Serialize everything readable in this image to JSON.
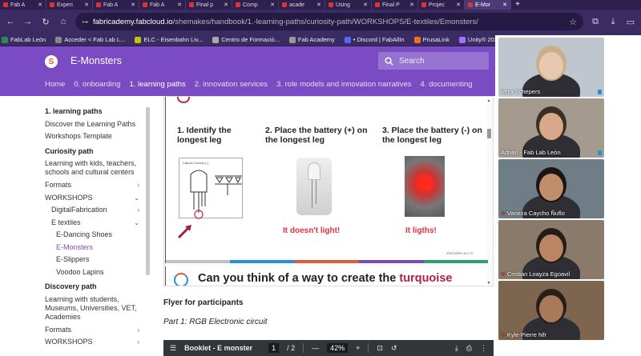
{
  "browser": {
    "tabs": [
      {
        "label": "Fab A",
        "active": false
      },
      {
        "label": "Experi",
        "active": false
      },
      {
        "label": "Fab A",
        "active": false
      },
      {
        "label": "Fab A",
        "active": false
      },
      {
        "label": "Final p",
        "active": false
      },
      {
        "label": "Comp",
        "active": false
      },
      {
        "label": "acade",
        "active": false
      },
      {
        "label": "Using",
        "active": false
      },
      {
        "label": "Final P",
        "active": false
      },
      {
        "label": "Projec",
        "active": false
      },
      {
        "label": "E-Mor",
        "active": true
      }
    ],
    "new_tab": "+",
    "url_host": "fabricademy.fabcloud.io",
    "url_path": "/shemakes/handbook/1.-learning-paths/curiosity-path/WORKSHOPS/E-textiles/Emonsters/",
    "bookmarks": [
      {
        "label": "FabLab León",
        "color": "#2e8b57"
      },
      {
        "label": "Acceder < Fab Lab L...",
        "color": "#888888"
      },
      {
        "label": "ELC - Eisenbahn Liv...",
        "color": "#c4c400"
      },
      {
        "label": "Centro de Formació...",
        "color": "#aaaaaa"
      },
      {
        "label": "Fab Academy",
        "color": "#999999"
      },
      {
        "label": "• Discord | FabAllIn",
        "color": "#5865f2"
      },
      {
        "label": "PrusaLink",
        "color": "#f07020"
      },
      {
        "label": "Unity® 2021 y C# |...",
        "color": "#a070ff"
      }
    ],
    "bookmarks_more": "Tod"
  },
  "site": {
    "title": "E-Monsters",
    "search_placeholder": "Search",
    "nav": [
      {
        "label": "Home",
        "active": false
      },
      {
        "label": "0. onboarding",
        "active": false
      },
      {
        "label": "1. learning paths",
        "active": true
      },
      {
        "label": "2. innovation services",
        "active": false
      },
      {
        "label": "3. role models and innovation narratives",
        "active": false
      },
      {
        "label": "4. documenting",
        "active": false
      }
    ]
  },
  "sidebar": {
    "section1_title": "1. learning paths",
    "discover": "Discover the Learning Paths",
    "workshops_template": "Workshops Template",
    "curiosity_title": "Curiosity path",
    "curiosity_desc": "Learning with kids, teachers, schools and cultural centers",
    "formats": "Formats",
    "workshops": "WORKSHOPS",
    "digital_fabrication": "DigitalFabrication",
    "e_textiles": "E textiles",
    "e_dancing_shoes": "E-Dancing Shoes",
    "e_monsters": "E-Monsters",
    "e_slippers": "E-Slippers",
    "voodoo": "Voodoo Lapins",
    "discovery_title": "Discovery path",
    "discovery_desc": "Learning with students, Museums, Universities, VET, Academies",
    "formats2": "Formats",
    "workshops2": "WORKSHOPS"
  },
  "slide": {
    "step1": "1. Identify the longest leg",
    "step2": "2. Place the battery (+) on the longest leg",
    "step3": "3. Place the battery (-) on the longest leg",
    "diagram_label": "Cátodo Común (-)",
    "no_light": "It doesn't light!",
    "lights": "It ligths!",
    "credit": "shemakes.eu | 5",
    "question_start": "Can you think of a way to create the ",
    "question_highlight": "turquoise",
    "bar_colors": [
      "#c0c0c0",
      "#2a8fd1",
      "#e05a3a",
      "#7b4bc4",
      "#2e9e6a"
    ]
  },
  "content": {
    "flyer": "Flyer for participants",
    "part1": "Part 1: RGB Electronic circuit"
  },
  "pdf_toolbar": {
    "menu": "☰",
    "title": "Booklet - E monster",
    "page_current": "1",
    "page_total": "/ 2",
    "zoom_out": "—",
    "zoom": "42%",
    "zoom_in": "+",
    "download": "⤓",
    "print": "⎙",
    "more": "⋮"
  },
  "call": {
    "participants": [
      {
        "name": "Vera Schepers",
        "muted": false,
        "bg": "#bfc6cf",
        "skin": "#e8c8ae",
        "hair": "#c9b08a"
      },
      {
        "name": "Adrian - Fab Lab León",
        "muted": false,
        "bg": "#a49a8d",
        "skin": "#d9a78c",
        "hair": "#3b2e26"
      },
      {
        "name": "Vaneza Caycho Ñuflo",
        "muted": true,
        "bg": "#6f7e86",
        "skin": "#c08e6b",
        "hair": "#1b1512"
      },
      {
        "name": "Cristian Loayza Egoavil",
        "muted": true,
        "bg": "#8a7a6a",
        "skin": "#b98562",
        "hair": "#251c16"
      },
      {
        "name": "Kyle-Pierre Nfr",
        "muted": true,
        "bg": "#7d6550",
        "skin": "#a97a5a",
        "hair": "#2a1f18"
      }
    ]
  }
}
